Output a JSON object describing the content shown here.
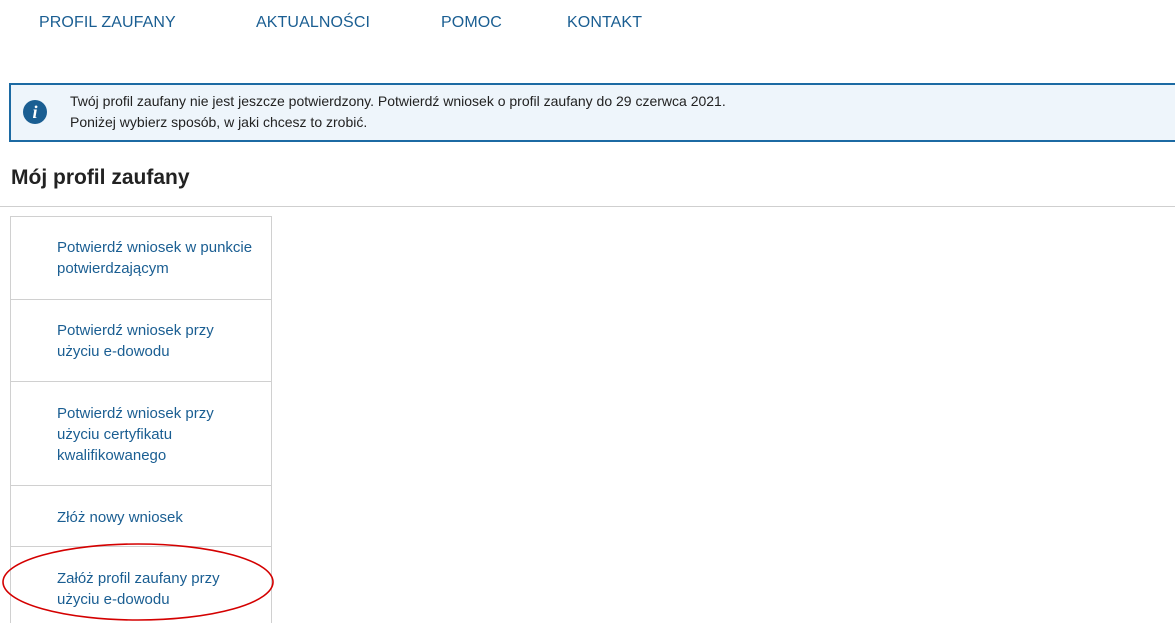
{
  "nav": {
    "items": [
      {
        "label": "PROFIL ZAUFANY"
      },
      {
        "label": "AKTUALNOŚCI"
      },
      {
        "label": "POMOC"
      },
      {
        "label": "KONTAKT"
      }
    ]
  },
  "info": {
    "icon": "info-icon",
    "line1": "Twój profil zaufany nie jest jeszcze potwierdzony. Potwierdź wniosek o profil zaufany do 29 czerwca 2021.",
    "line2": "Poniżej wybierz sposób, w jaki chcesz to zrobić."
  },
  "page": {
    "title": "Mój profil zaufany"
  },
  "menu": {
    "items": [
      {
        "label": "Potwierdź wniosek w punkcie potwierdzającym"
      },
      {
        "label": "Potwierdź wniosek przy użyciu e-dowodu"
      },
      {
        "label": "Potwierdź wniosek przy użyciu certyfikatu kwalifikowanego"
      },
      {
        "label": "Złóż nowy wniosek"
      },
      {
        "label": "Załóż profil zaufany przy użyciu e-dowodu"
      }
    ]
  },
  "colors": {
    "link": "#1a5e92",
    "banner_border": "#1c6aa3",
    "banner_bg": "#eef5fb",
    "highlight": "#d40000"
  }
}
